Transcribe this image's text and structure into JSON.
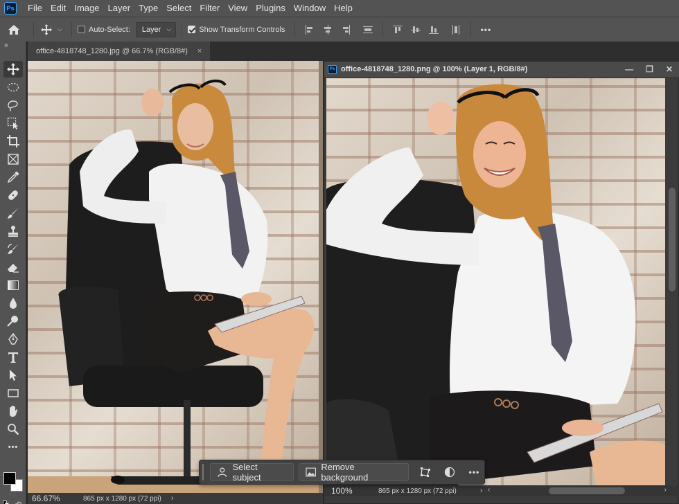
{
  "menu": {
    "items": [
      "File",
      "Edit",
      "Image",
      "Layer",
      "Type",
      "Select",
      "Filter",
      "View",
      "Plugins",
      "Window",
      "Help"
    ],
    "logo": "Ps"
  },
  "options": {
    "auto_select_label": "Auto-Select:",
    "auto_select_checked": false,
    "target_value": "Layer",
    "show_transform_label": "Show Transform Controls",
    "show_transform_checked": true,
    "more_label": "•••"
  },
  "doc1": {
    "tab_title": "office-4818748_1280.jpg @ 66.7% (RGB/8#)",
    "close_glyph": "×",
    "zoom": "66.67%",
    "dimensions": "865 px x 1280 px (72 ppi)",
    "chevron": "›"
  },
  "doc2": {
    "window_title": "office-4818748_1280.png @ 100% (Layer 1, RGB/8#)",
    "logo": "Ps",
    "zoom": "100%",
    "dimensions": "865 px x 1280 px (72 ppi)",
    "chevron": "›",
    "minimize_glyph": "—",
    "restore_glyph": "❐",
    "close_glyph": "✕"
  },
  "taskbar": {
    "select_subject_label": "Select subject",
    "remove_background_label": "Remove background",
    "more_label": "•••"
  },
  "toolbar": {
    "expand_glyph": "»",
    "tools": [
      "move-tool",
      "marquee-tool",
      "lasso-tool",
      "object-selection-tool",
      "crop-tool",
      "frame-tool",
      "eyedropper-tool",
      "healing-brush-tool",
      "brush-tool",
      "clone-stamp-tool",
      "history-brush-tool",
      "eraser-tool",
      "gradient-tool",
      "blur-tool",
      "dodge-tool",
      "pen-tool",
      "type-tool",
      "path-selection-tool",
      "rectangle-tool",
      "hand-tool",
      "zoom-tool",
      "more-tools"
    ],
    "more_glyph": "•••",
    "swap_glyph": "↶",
    "foreground_color": "#000000",
    "background_color": "#ffffff"
  },
  "colors": {
    "ui_panel": "#535353",
    "ui_dark": "#282828",
    "accent_blue": "#31a8ff"
  }
}
